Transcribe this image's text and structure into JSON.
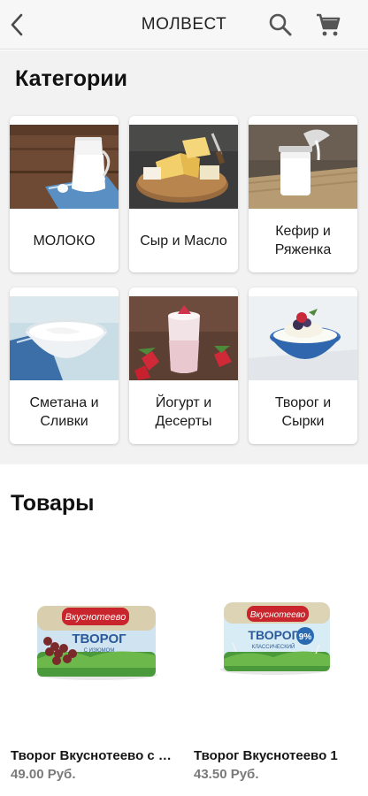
{
  "header": {
    "title": "МОЛВЕСТ",
    "back_icon": "chevron-left-icon",
    "search_icon": "search-icon",
    "cart_icon": "cart-icon"
  },
  "categories": {
    "title": "Категории",
    "items": [
      {
        "label": "МОЛОКО",
        "image": "milk-jug-image"
      },
      {
        "label": "Сыр и Масло",
        "image": "cheese-board-image"
      },
      {
        "label": "Кефир и\nРяженка",
        "image": "kefir-bottle-image"
      },
      {
        "label": "Сметана и\nСливки",
        "image": "sour-cream-bowl-image"
      },
      {
        "label": "Йогурт и\nДесерты",
        "image": "yogurt-cup-image"
      },
      {
        "label": "Творог и\nСырки",
        "image": "cottage-cheese-bowl-image"
      }
    ]
  },
  "products": {
    "title": "Товары",
    "items": [
      {
        "name": "Творог Вкуснотеево с изюмом",
        "price": "49.00 Руб.",
        "brand_text": "Вкуснотеево",
        "label_text": "ТВОРОГ",
        "sub_text": "С ИЗЮМОМ"
      },
      {
        "name": "Творог Вкуснотеево 1",
        "price": "43.50 Руб.",
        "brand_text": "Вкуснотеево",
        "label_text": "ТВОРОГ",
        "sub_text": "КЛАССИЧЕСКИЙ",
        "fat_text": "9%"
      }
    ]
  },
  "colors": {
    "brand_red": "#c8262c",
    "price_gray": "#7a7a7a",
    "category_bg": "#f2f2f2"
  }
}
